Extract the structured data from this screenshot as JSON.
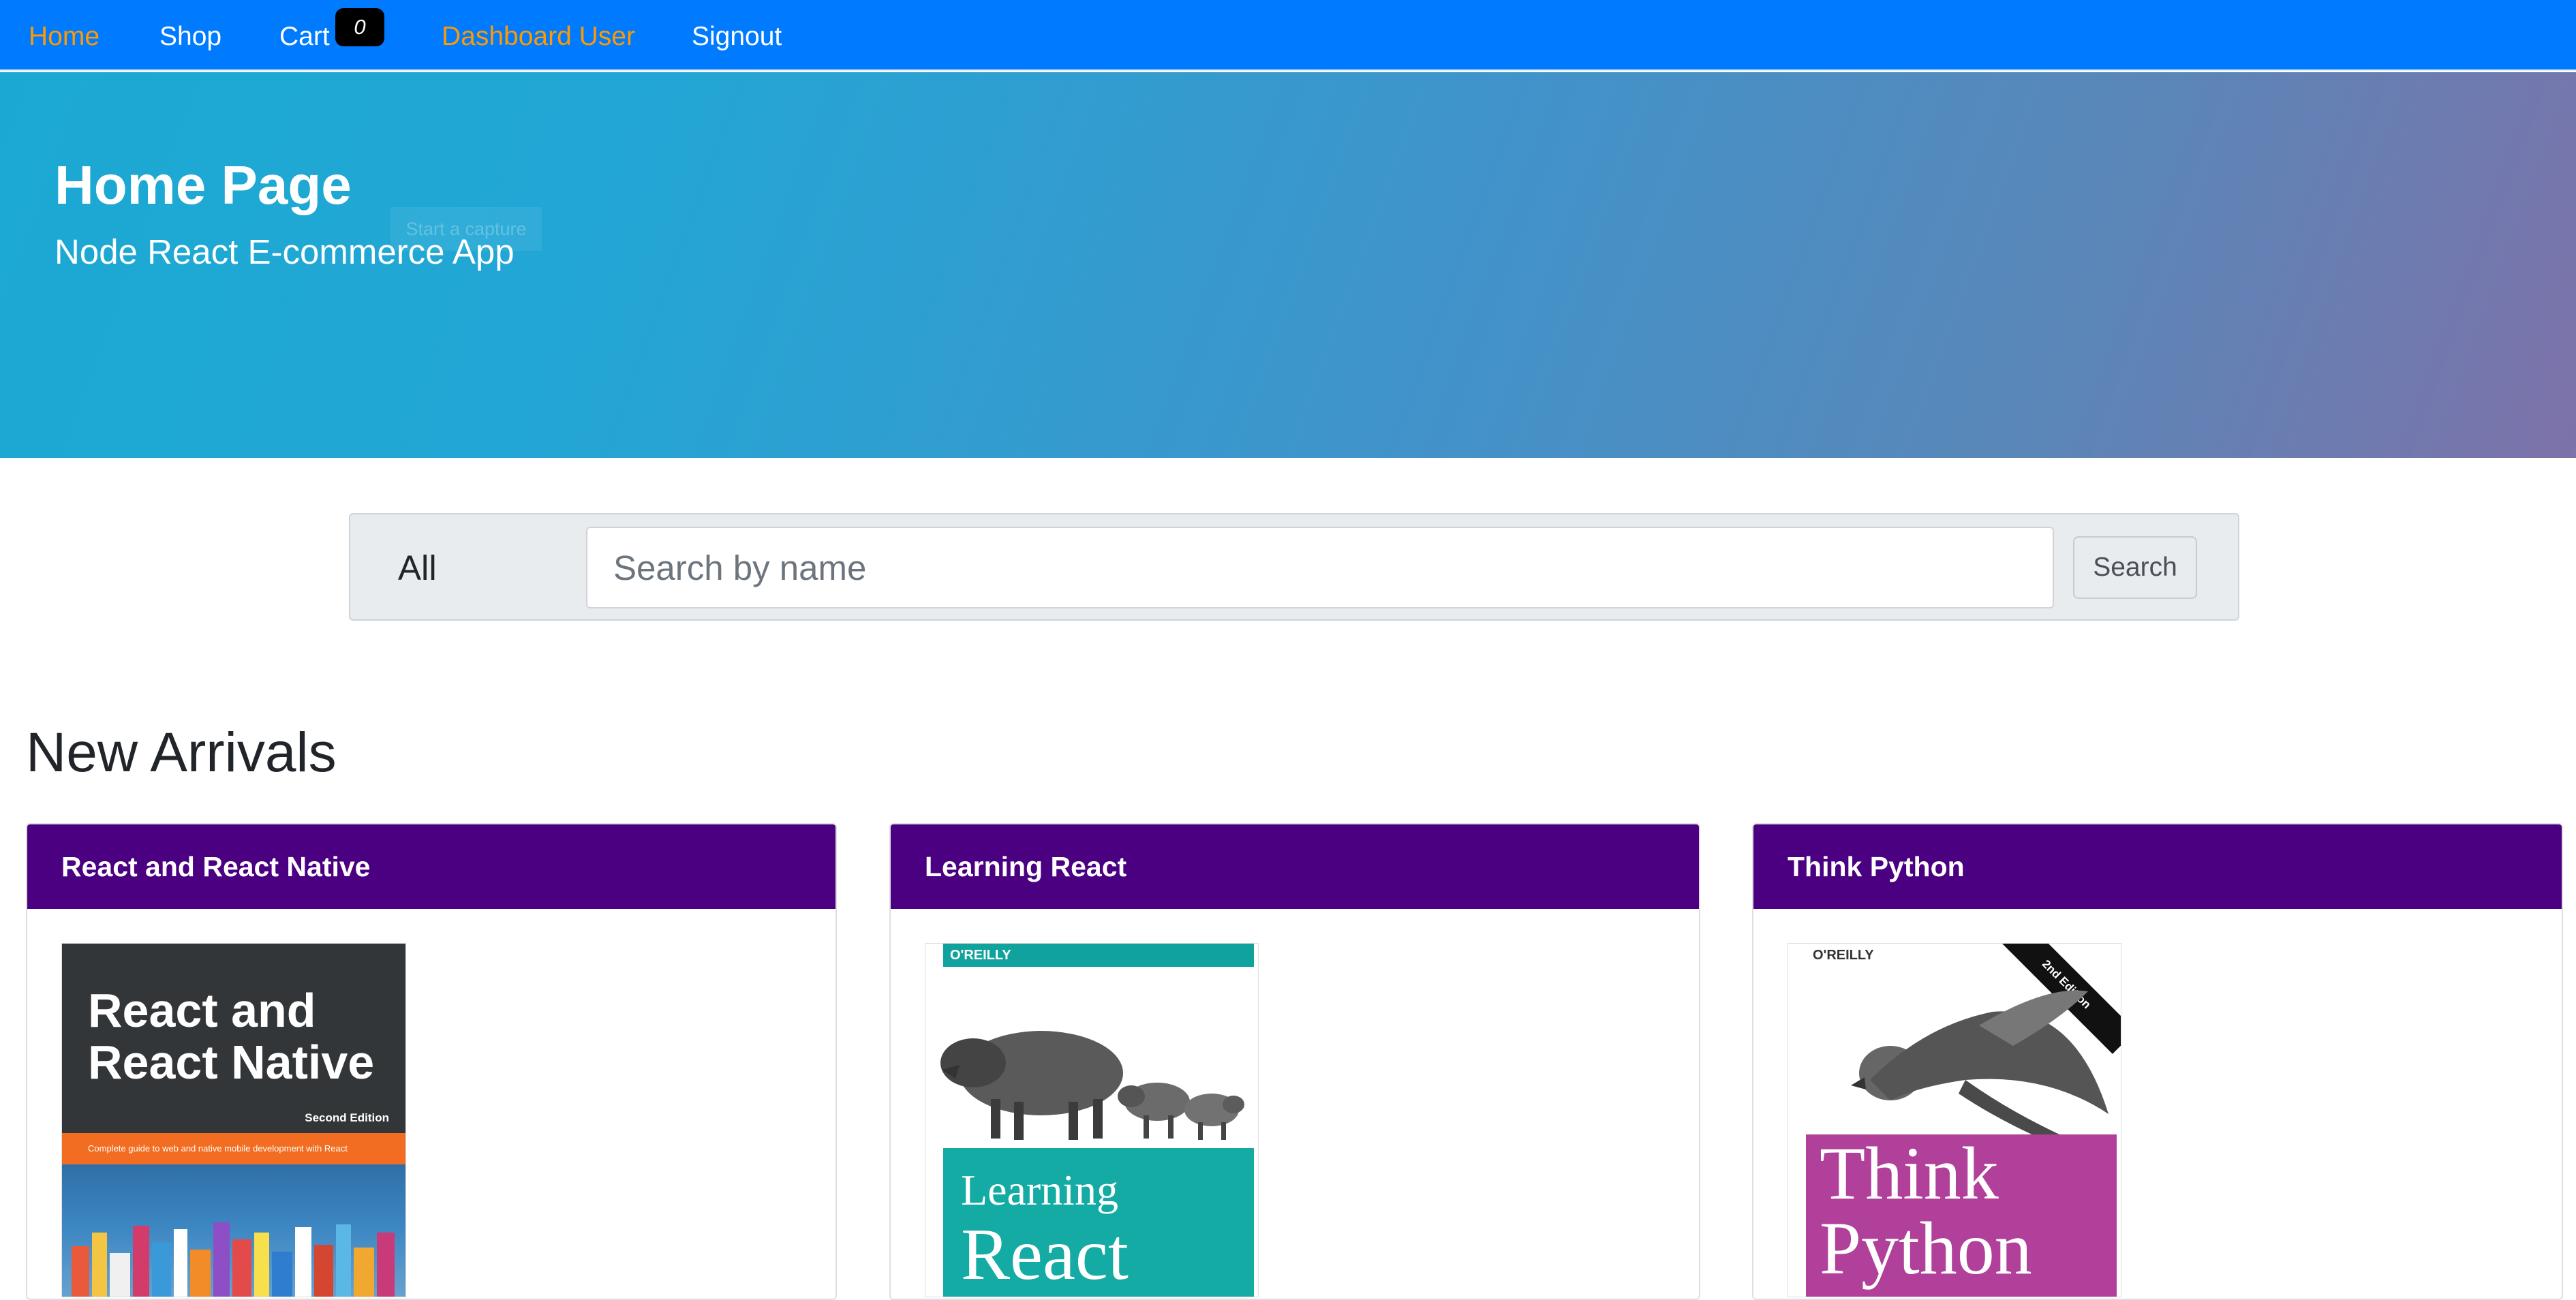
{
  "navbar": {
    "items": [
      {
        "label": "Home",
        "active": true
      },
      {
        "label": "Shop",
        "active": false
      },
      {
        "label": "Cart",
        "active": false
      },
      {
        "label": "Dashboard User",
        "active": true
      },
      {
        "label": "Signout",
        "active": false
      }
    ],
    "cart_count": "0"
  },
  "jumbotron": {
    "title": "Home Page",
    "subtitle": "Node React E-commerce App",
    "capture_tooltip": "Start a capture"
  },
  "search": {
    "category_selected": "All",
    "placeholder": "Search by name",
    "button_label": "Search"
  },
  "new_arrivals": {
    "heading": "New Arrivals",
    "products": [
      {
        "name": "React and React Native",
        "cover": {
          "title_line1": "React and",
          "title_line2": "React Native",
          "edition": "Second Edition",
          "tagline": "Complete guide to web and native mobile development with React"
        }
      },
      {
        "name": "Learning React",
        "cover": {
          "publisher": "O'REILLY",
          "title_line1": "Learning",
          "title_line2": "React"
        }
      },
      {
        "name": "Think Python",
        "cover": {
          "publisher": "O'REILLY",
          "title_line1": "Think",
          "title_line2": "Python",
          "ribbon": "2nd Edition"
        }
      }
    ]
  },
  "colors": {
    "navbar_bg": "#007bff",
    "nav_active": "#ff9900",
    "card_header_bg": "#4b0082",
    "jumbotron_start": "#1ba9d3",
    "jumbotron_end": "#7d72a9"
  }
}
